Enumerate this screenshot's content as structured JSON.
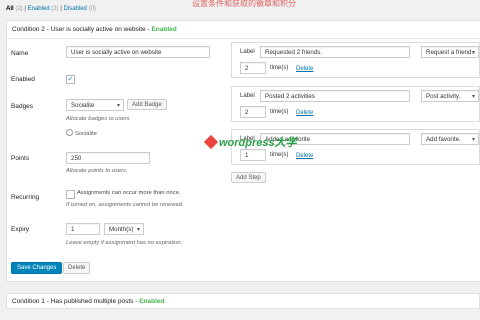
{
  "top_watermark": "设置条件和获取的徽章和积分",
  "filters": {
    "all_label": "All",
    "all_count": "(2)",
    "enabled_label": "Enabled",
    "enabled_count": "(2)",
    "disabled_label": "Disabled",
    "disabled_count": "(0)",
    "sep": "|"
  },
  "condition2": {
    "title": "Condition 2 - User is socially active on website",
    "status": "Enabled",
    "name_label": "Name",
    "name_value": "User is socially active on website",
    "enabled_label": "Enabled",
    "enabled_checked": true,
    "badges_label": "Badges",
    "badge_select": "Socialite",
    "add_badge": "Add Badge",
    "badges_hint": "Allocate badges to users",
    "badge_chip": "Socialite",
    "points_label": "Points",
    "points_value": "250",
    "points_hint": "Allocate points to users.",
    "recurring_label": "Recurring",
    "recurring_checkbox_text": "Assignments can occur more than once.",
    "recurring_hint": "If turned on, assignments cannot be renewed.",
    "expiry_label": "Expiry",
    "expiry_value": "1",
    "expiry_unit": "Month(s)",
    "expiry_hint": "Leave empty if assignment has no expiration.",
    "save_button": "Save Changes",
    "delete_button": "Delete"
  },
  "steps": [
    {
      "label": "Label",
      "label_value": "Requested 2 friends.",
      "action": "Request a friend.",
      "count": "2",
      "times": "time(s)",
      "delete": "Delete"
    },
    {
      "label": "Label",
      "label_value": "Posted 2 activities",
      "action": "Post activity.",
      "count": "2",
      "times": "time(s)",
      "delete": "Delete"
    },
    {
      "label": "Label",
      "label_value": "Added a favorite",
      "action": "Add favorite.",
      "count": "1",
      "times": "time(s)",
      "delete": "Delete"
    }
  ],
  "add_step": "Add Step",
  "wp_watermark": "wordpress大学",
  "condition1": {
    "title": "Condition 1 - Has published multiple posts",
    "status": "Enabled"
  }
}
